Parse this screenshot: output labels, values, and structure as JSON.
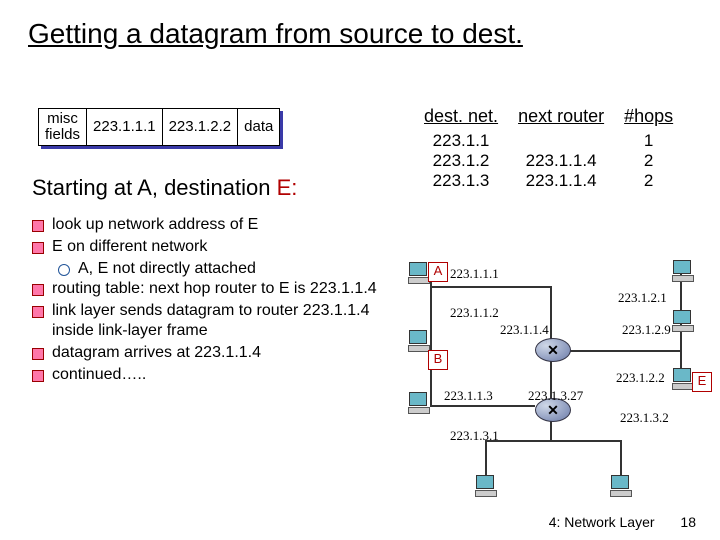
{
  "title": "Getting a datagram from source to dest.",
  "datagram": {
    "misc_top": "misc",
    "misc_bot": "fields",
    "src": "223.1.1.1",
    "dst": "223.1.2.2",
    "data": "data"
  },
  "subhead_prefix": "Starting at A, destination ",
  "subhead_dest": "E:",
  "bullets": [
    "look up network address of E",
    "E on different network",
    "routing table: next hop router to E is 223.1.1.4",
    "link layer sends datagram to router 223.1.1.4 inside link-layer frame",
    "datagram arrives at 223.1.1.4",
    "continued….."
  ],
  "sub_bullet": "A, E not directly attached",
  "routing": {
    "h_dest": "dest. net.",
    "h_next": "next router",
    "h_hops": "#hops",
    "rows": [
      {
        "dest": "223.1.1",
        "next": "",
        "hops": "1"
      },
      {
        "dest": "223.1.2",
        "next": "223.1.1.4",
        "hops": "2"
      },
      {
        "dest": "223.1.3",
        "next": "223.1.1.4",
        "hops": "2"
      }
    ]
  },
  "diagram": {
    "tag_a": "A",
    "tag_b": "B",
    "tag_e": "E",
    "ips": {
      "a": "223.1.1.1",
      "mid1": "223.1.1.2",
      "r1": "223.1.1.4",
      "b": "223.1.1.3",
      "top_r": "223.1.2.1",
      "right_r": "223.1.2.9",
      "e": "223.1.2.2",
      "r2": "223.1.3.27",
      "bl": "223.1.3.1",
      "br": "223.1.3.2"
    }
  },
  "footer": {
    "label": "4: Network Layer",
    "page": "18"
  }
}
